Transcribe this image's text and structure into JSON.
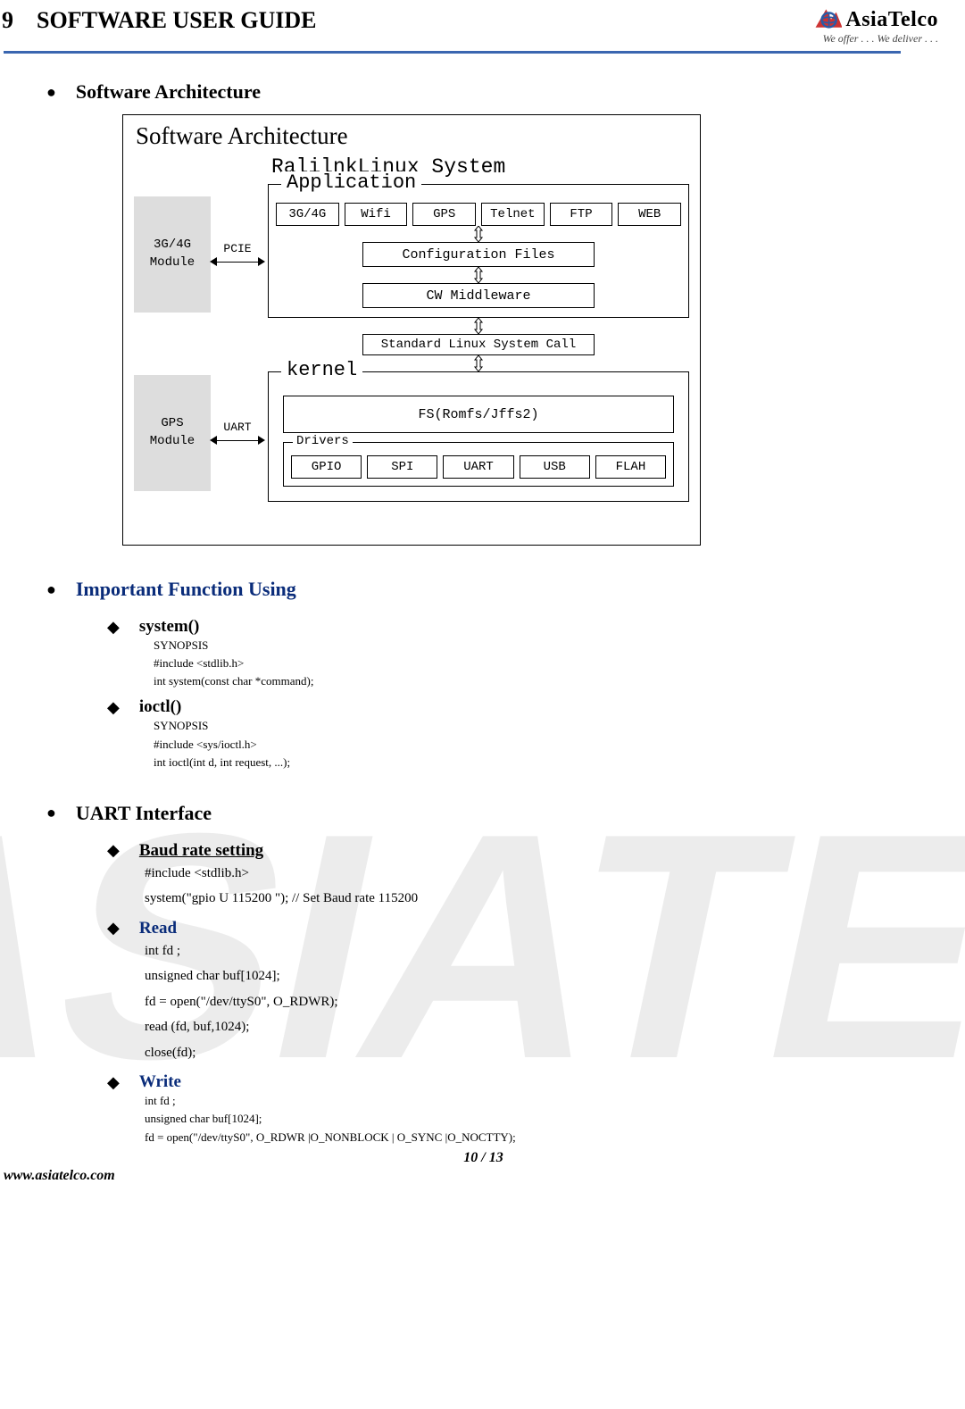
{
  "header": {
    "chapter_num": "9",
    "chapter_title": "SOFTWARE USER GUIDE",
    "logo_name": "AsiaTelco",
    "logo_tag": "We offer . . . We deliver . . ."
  },
  "sections": {
    "sw_arch": {
      "title": "Software Architecture"
    },
    "important_fn": {
      "title": "Important Function Using",
      "system": {
        "name": "system()",
        "l1": "SYNOPSIS",
        "l2": " #include <stdlib.h>",
        "l3": "int system(const char *command);"
      },
      "ioctl": {
        "name": "ioctl()",
        "l1": "SYNOPSIS",
        "l2": "#include <sys/ioctl.h>",
        "l3": "int ioctl(int d, int request, ...);"
      }
    },
    "uart": {
      "title": "UART Interface",
      "baud": {
        "name": "Baud rate setting",
        "l1": "#include <stdlib.h>",
        "l2": "system(\"gpio U 115200 \");    // Set Baud rate 115200"
      },
      "read": {
        "name": "Read",
        "l1": "int fd ;",
        "l2": "unsigned char buf[1024];",
        "l3": "fd = open(\"/dev/ttyS0\", O_RDWR);",
        "l4": "read (fd, buf,1024);",
        "l5": "close(fd);"
      },
      "write": {
        "name": "Write",
        "l1": "int fd ;",
        "l2": "unsigned char buf[1024];",
        "l3": "fd = open(\"/dev/ttyS0\", O_RDWR |O_NONBLOCK | O_SYNC |O_NOCTTY);"
      }
    }
  },
  "diagram": {
    "title": "Software Architecture",
    "mod1_l1": "3G/4G",
    "mod1_l2": "Module",
    "conn1": "PCIE",
    "mod2_l1": "GPS",
    "mod2_l2": "Module",
    "conn2": "UART",
    "sys_title": "RalilnkLinux System",
    "app_label": "Application",
    "app_cells": [
      "3G/4G",
      "Wifi",
      "GPS",
      "Telnet",
      "FTP",
      "WEB"
    ],
    "cfg": "Configuration Files",
    "mw": "CW Middleware",
    "std": "Standard Linux System Call",
    "kernel_label": "kernel",
    "fs": "FS(Romfs/Jffs2)",
    "drv_label": "Drivers",
    "drv_cells": [
      "GPIO",
      "SPI",
      "UART",
      "USB",
      "FLAH"
    ]
  },
  "footer": {
    "page": "10 / 13",
    "url": "www.asiatelco.com"
  }
}
